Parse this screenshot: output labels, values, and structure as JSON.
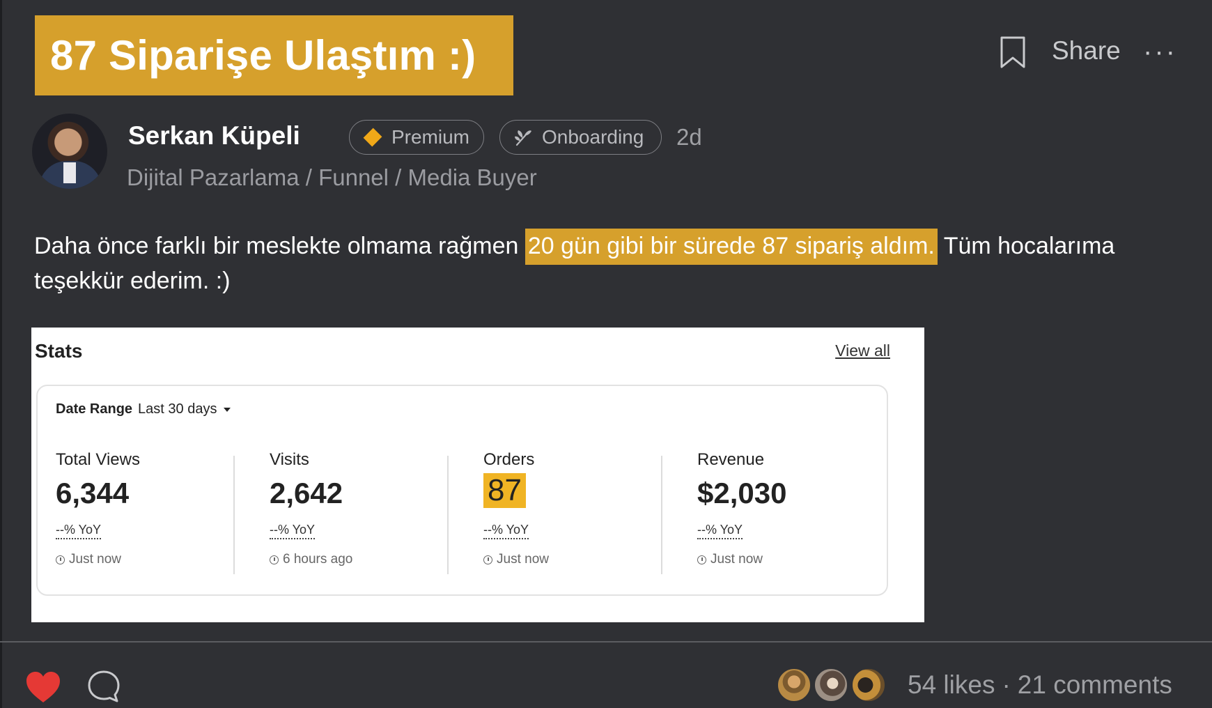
{
  "post": {
    "title": "87 Siparişe Ulaştım :)",
    "actions": {
      "share_label": "Share",
      "more_label": "···"
    },
    "author": {
      "name": "Serkan Küpeli",
      "badges": {
        "premium": "Premium",
        "onboarding": "Onboarding"
      },
      "posted_ago": "2d",
      "subtitle": "Dijital Pazarlama / Funnel / Media Buyer"
    },
    "body": {
      "before": "Daha önce farklı bir meslekte olmama rağmen ",
      "highlight": "20 gün gibi bir sürede 87 sipariş aldım.",
      "after": " Tüm hocalarıma teşekkür ederim. :)"
    },
    "footer": {
      "likes": "54 likes",
      "separator": "·",
      "comments": "21 comments"
    }
  },
  "stats": {
    "heading": "Stats",
    "view_all": "View all",
    "date_range_label": "Date Range",
    "date_range_value": "Last 30 days",
    "metrics": [
      {
        "label": "Total Views",
        "value": "6,344",
        "yoy": "--% YoY",
        "updated": "Just now"
      },
      {
        "label": "Visits",
        "value": "2,642",
        "yoy": "--% YoY",
        "updated": "6 hours ago"
      },
      {
        "label": "Orders",
        "value": "87",
        "yoy": "--% YoY",
        "updated": "Just now"
      },
      {
        "label": "Revenue",
        "value": "$2,030",
        "yoy": "--% YoY",
        "updated": "Just now"
      }
    ]
  },
  "colors": {
    "background": "#2f3034",
    "accent": "#d6a02c",
    "heart": "#e53935",
    "orders_highlight": "#f0b424"
  },
  "icons": [
    "bookmark-icon",
    "more-icon",
    "diamond-icon",
    "sprout-icon",
    "clock-icon",
    "heart-icon",
    "comment-icon"
  ]
}
